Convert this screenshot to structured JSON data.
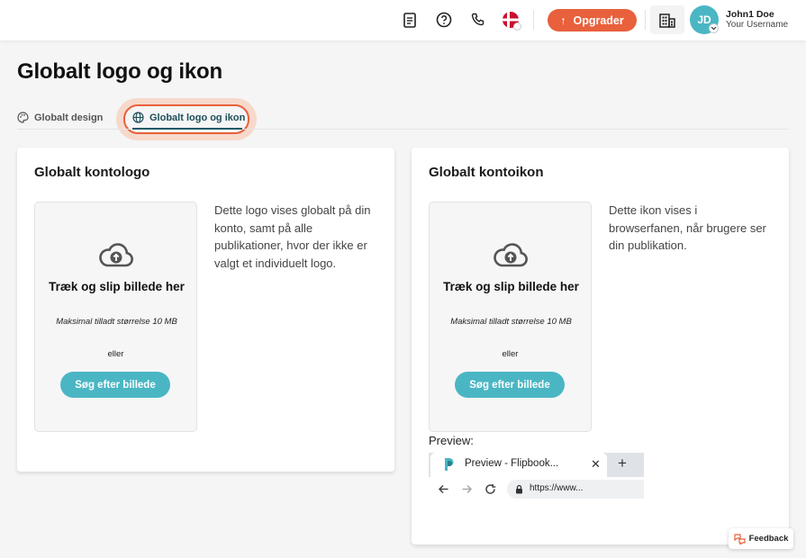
{
  "header": {
    "icons": [
      "document-icon",
      "help-icon",
      "phone-icon",
      "flag-dk-icon",
      "building-icon"
    ],
    "upgrade_label": "Opgrader",
    "user": {
      "initials": "JD",
      "name": "John1 Doe",
      "username": "Your Username"
    }
  },
  "page": {
    "title": "Globalt logo og ikon"
  },
  "tabs": [
    {
      "label": "Globalt design",
      "icon": "palette-icon",
      "active": false
    },
    {
      "label": "Globalt logo og ikon",
      "icon": "globe-icon",
      "active": true
    }
  ],
  "logo_card": {
    "title": "Globalt kontologo",
    "dropzone": {
      "title": "Træk og slip billede her",
      "max_size": "Maksimal tilladt størrelse 10 MB",
      "or": "eller",
      "button": "Søg efter billede"
    },
    "description": "Dette logo vises globalt på din konto, samt på alle publikationer, hvor der ikke er valgt et individuelt logo."
  },
  "icon_card": {
    "title": "Globalt kontoikon",
    "dropzone": {
      "title": "Træk og slip billede her",
      "max_size": "Maksimal tilladt størrelse 10 MB",
      "or": "eller",
      "button": "Søg efter billede"
    },
    "description": "Dette ikon vises i browserfanen, når brugere ser din publikation.",
    "preview": {
      "label": "Preview:",
      "tab_title": "Preview - Flipbook...",
      "close": "✕",
      "new_tab": "+",
      "url": "https://www..."
    }
  },
  "feedback": {
    "label": "Feedback"
  },
  "colors": {
    "accent": "#e8603c",
    "teal": "#4ab6c4",
    "tab_active": "#1d5a66"
  }
}
